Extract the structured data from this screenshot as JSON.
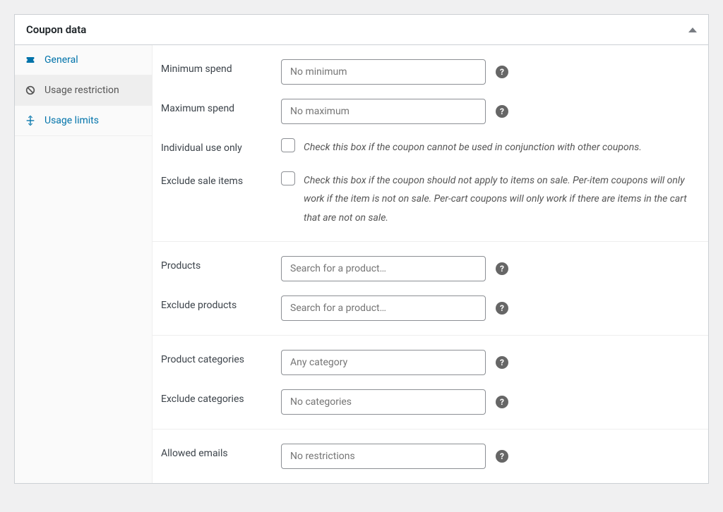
{
  "panel": {
    "title": "Coupon data"
  },
  "tabs": {
    "general": "General",
    "usage_restriction": "Usage restriction",
    "usage_limits": "Usage limits"
  },
  "fields": {
    "min_spend": {
      "label": "Minimum spend",
      "placeholder": "No minimum"
    },
    "max_spend": {
      "label": "Maximum spend",
      "placeholder": "No maximum"
    },
    "individual_use": {
      "label": "Individual use only",
      "desc": "Check this box if the coupon cannot be used in conjunction with other coupons."
    },
    "exclude_sale": {
      "label": "Exclude sale items",
      "desc": "Check this box if the coupon should not apply to items on sale. Per-item coupons will only work if the item is not on sale. Per-cart coupons will only work if there are items in the cart that are not on sale."
    },
    "products": {
      "label": "Products",
      "placeholder": "Search for a product…"
    },
    "exclude_products": {
      "label": "Exclude products",
      "placeholder": "Search for a product…"
    },
    "product_categories": {
      "label": "Product categories",
      "placeholder": "Any category"
    },
    "exclude_categories": {
      "label": "Exclude categories",
      "placeholder": "No categories"
    },
    "allowed_emails": {
      "label": "Allowed emails",
      "placeholder": "No restrictions"
    }
  },
  "help_glyph": "?"
}
